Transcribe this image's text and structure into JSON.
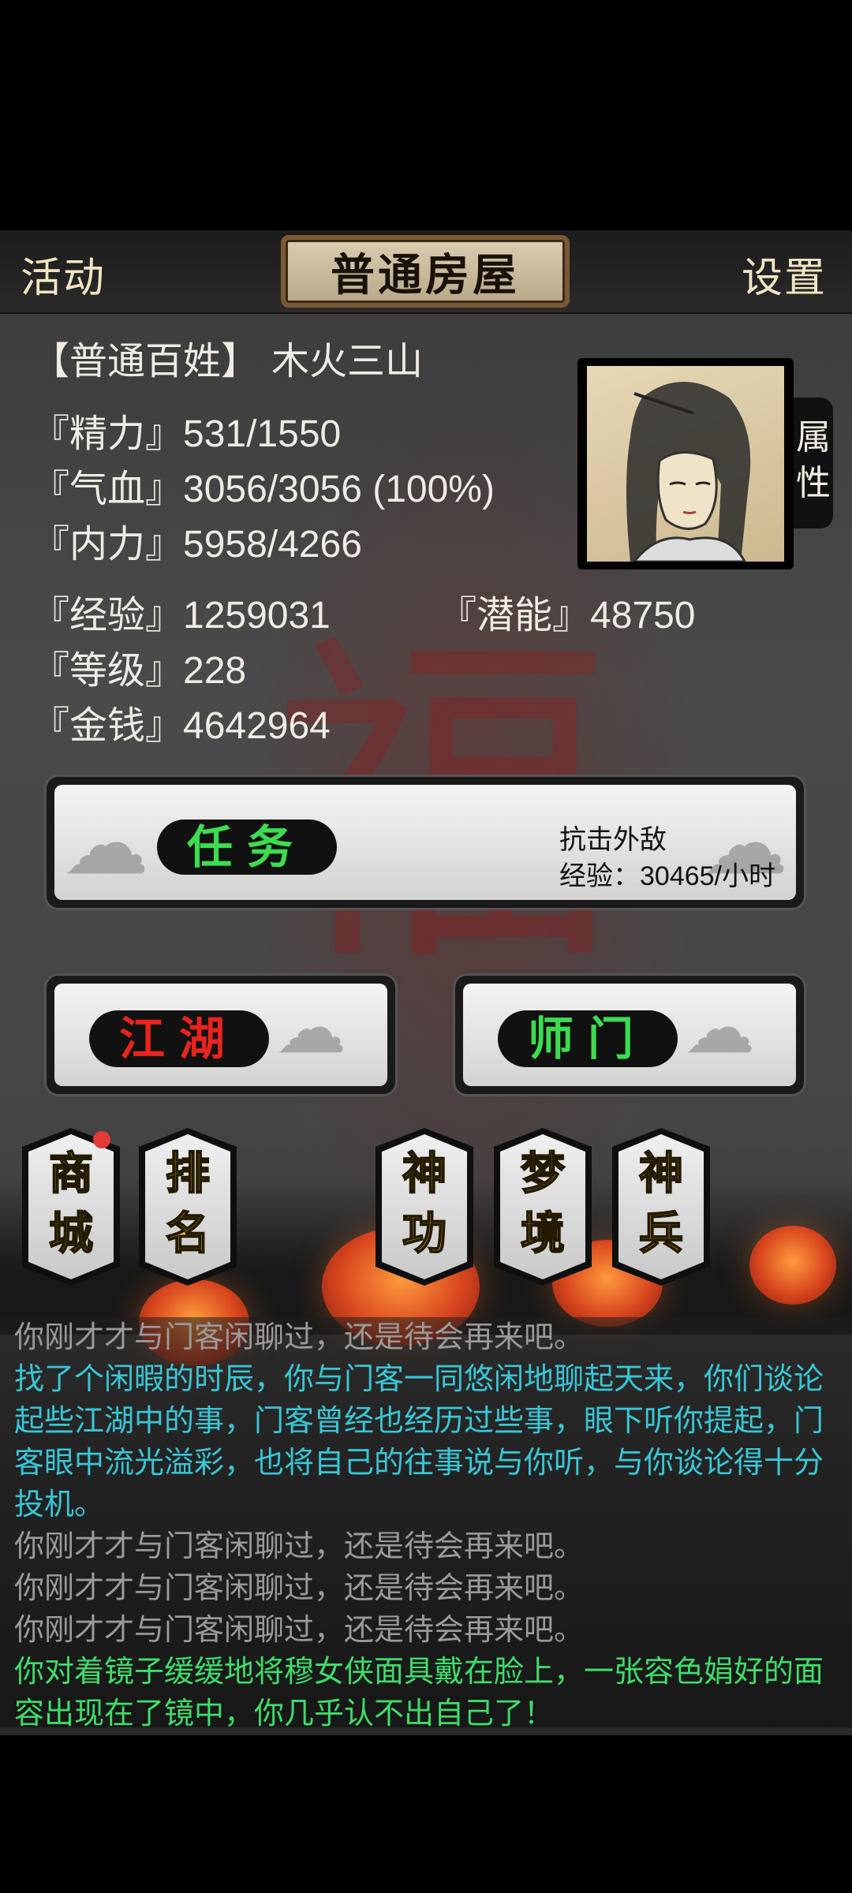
{
  "header": {
    "left_label": "活动",
    "title": "普通房屋",
    "right_label": "设置"
  },
  "player": {
    "rank": "【普通百姓】",
    "name": "木火三山"
  },
  "stats": {
    "jingli": "『精力』531/1550",
    "qixue": "『气血』3056/3056 (100%)",
    "neili": "『内力』5958/4266",
    "jingyan": "『经验』1259031",
    "qianneng": "『潜能』48750",
    "dengji": "『等级』228",
    "jinqian": "『金钱』4642964"
  },
  "attr_tab": {
    "line1": "属",
    "line2": "性"
  },
  "task": {
    "label": "任务",
    "info1": "抗击外敌",
    "info2": "经验：30465/小时"
  },
  "jianghu": {
    "label": "江湖"
  },
  "shimen": {
    "label": "师门"
  },
  "tiles": [
    {
      "line1": "商",
      "line2": "城",
      "badge": true
    },
    {
      "line1": "排",
      "line2": "名"
    },
    {
      "line1": "神",
      "line2": "功"
    },
    {
      "line1": "梦",
      "line2": "境"
    },
    {
      "line1": "神",
      "line2": "兵"
    }
  ],
  "log": [
    {
      "text": "你刚才才与门客闲聊过，还是待会再来吧。",
      "color": "#9a9a9a"
    },
    {
      "text": "找了个闲暇的时辰，你与门客一同悠闲地聊起天来，你们谈论起些江湖中的事，门客曾经也经历过些事，眼下听你提起，门客眼中流光溢彩，也将自己的往事说与你听，与你谈论得十分投机。",
      "color": "#39c6d6"
    },
    {
      "text": "你刚才才与门客闲聊过，还是待会再来吧。",
      "color": "#9a9a9a"
    },
    {
      "text": "你刚才才与门客闲聊过，还是待会再来吧。",
      "color": "#9a9a9a"
    },
    {
      "text": "你刚才才与门客闲聊过，还是待会再来吧。",
      "color": "#9a9a9a"
    },
    {
      "text": "你对着镜子缓缓地将穆女侠面具戴在脸上，一张容色娟好的面容出现在了镜中，你几乎认不出自己了！",
      "color": "#3fdc6a"
    }
  ],
  "colors": {
    "task_green": "#3ddc50",
    "jianghu_red": "#e8241e",
    "shimen_green": "#3ddc50"
  }
}
